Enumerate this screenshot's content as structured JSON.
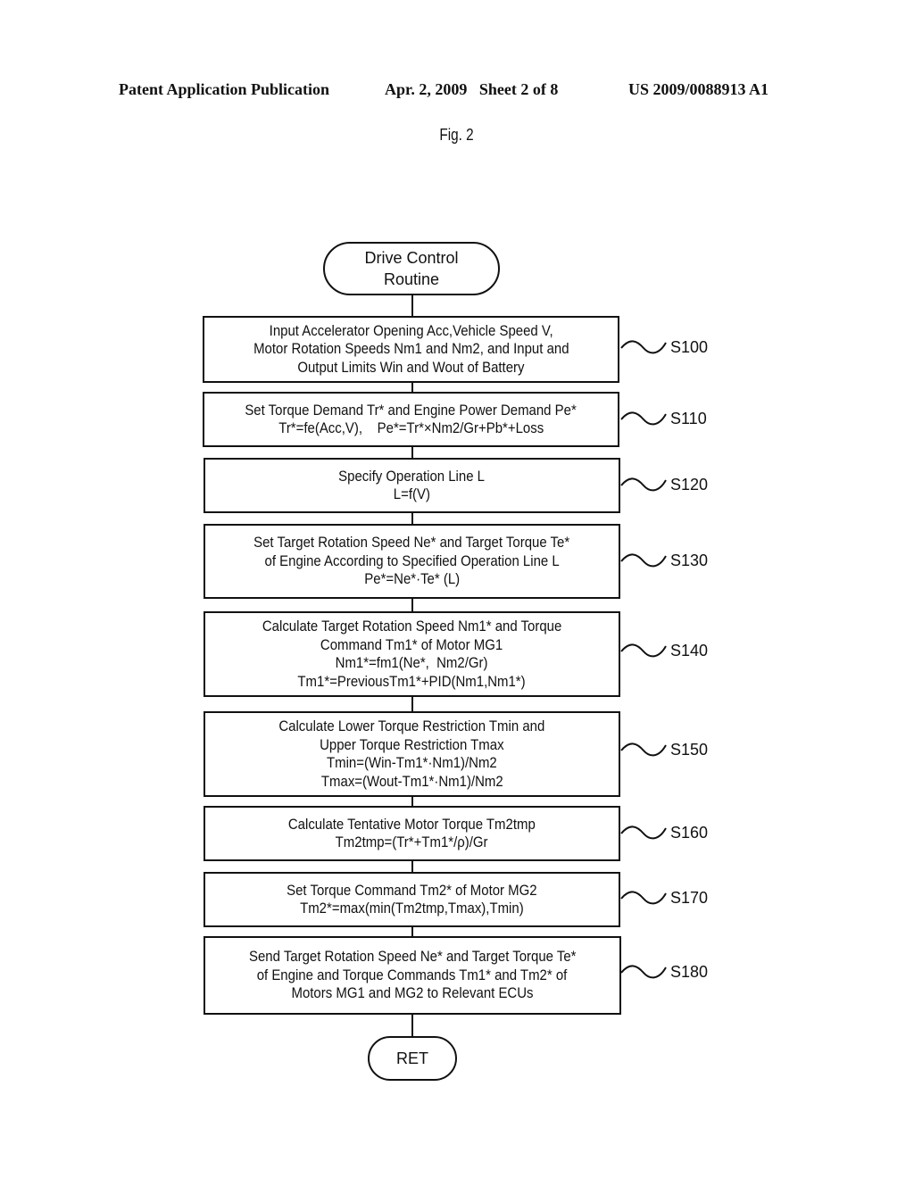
{
  "header": {
    "publication": "Patent Application Publication",
    "date_sheet": "Apr. 2, 2009   Sheet 2 of 8",
    "number": "US 2009/0088913 A1"
  },
  "figure_label": "Fig. 2",
  "start": {
    "lines": [
      "Drive Control",
      "Routine"
    ]
  },
  "end": {
    "label": "RET"
  },
  "steps": [
    {
      "id": "S100",
      "lines": [
        "Input Accelerator Opening Acc,Vehicle Speed V,",
        "Motor Rotation Speeds Nm1 and Nm2, and Input and",
        "Output Limits Win and Wout of Battery"
      ]
    },
    {
      "id": "S110",
      "lines": [
        "Set Torque Demand Tr* and Engine Power Demand Pe*",
        "Tr*=fe(Acc,V),    Pe*=Tr*×Nm2/Gr+Pb*+Loss"
      ]
    },
    {
      "id": "S120",
      "lines": [
        "Specify Operation Line L",
        "L=f(V)"
      ]
    },
    {
      "id": "S130",
      "lines": [
        "Set Target Rotation Speed Ne* and Target Torque Te*",
        "of Engine According to Specified Operation Line L",
        "Pe*=Ne*·Te* (L)"
      ]
    },
    {
      "id": "S140",
      "lines": [
        "Calculate Target Rotation Speed Nm1* and Torque",
        "Command Tm1* of Motor MG1",
        "Nm1*=fm1(Ne*,  Nm2/Gr)",
        "Tm1*=PreviousTm1*+PID(Nm1,Nm1*)"
      ]
    },
    {
      "id": "S150",
      "lines": [
        "Calculate Lower Torque Restriction Tmin and",
        "Upper Torque Restriction Tmax",
        "Tmin=(Win-Tm1*·Nm1)/Nm2",
        "Tmax=(Wout-Tm1*·Nm1)/Nm2"
      ]
    },
    {
      "id": "S160",
      "lines": [
        "Calculate Tentative Motor Torque Tm2tmp",
        "Tm2tmp=(Tr*+Tm1*/ρ)/Gr"
      ]
    },
    {
      "id": "S170",
      "lines": [
        "Set Torque Command Tm2* of Motor MG2",
        "Tm2*=max(min(Tm2tmp,Tmax),Tmin)"
      ]
    },
    {
      "id": "S180",
      "lines": [
        "Send Target Rotation Speed Ne* and Target Torque Te*",
        "of Engine and Torque Commands Tm1* and Tm2* of",
        "Motors MG1 and MG2 to Relevant ECUs"
      ]
    }
  ]
}
